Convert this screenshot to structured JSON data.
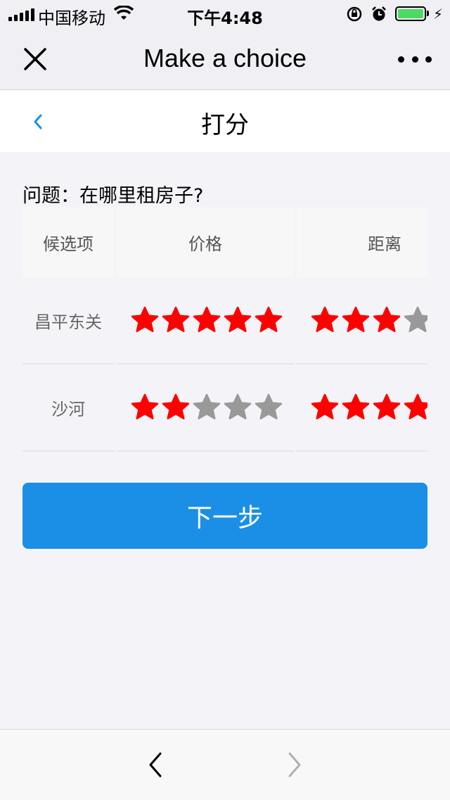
{
  "status_bar": {
    "carrier": "中国移动",
    "time": "下午4:48",
    "battery_color": "#4cd964"
  },
  "nav": {
    "title": "Make a choice",
    "close_icon": "close-icon",
    "more_icon": "more-dots-icon"
  },
  "page": {
    "title": "打分",
    "back_icon": "chevron-left-icon",
    "accent_color": "#1b8fe6"
  },
  "question": "问题：在哪里租房子?",
  "table": {
    "headers": [
      "候选项",
      "价格",
      "距离"
    ],
    "rows": [
      {
        "label": "昌平东关",
        "price_rating": 5,
        "distance_rating": 3
      },
      {
        "label": "沙河",
        "price_rating": 2,
        "distance_rating": 4
      }
    ],
    "star_on_color": "#ff0000",
    "star_off_color": "#999999",
    "max_stars": 5
  },
  "next_button": "下一步",
  "bottom_bar": {
    "back_icon": "chevron-left-icon",
    "forward_icon": "chevron-right-icon"
  }
}
